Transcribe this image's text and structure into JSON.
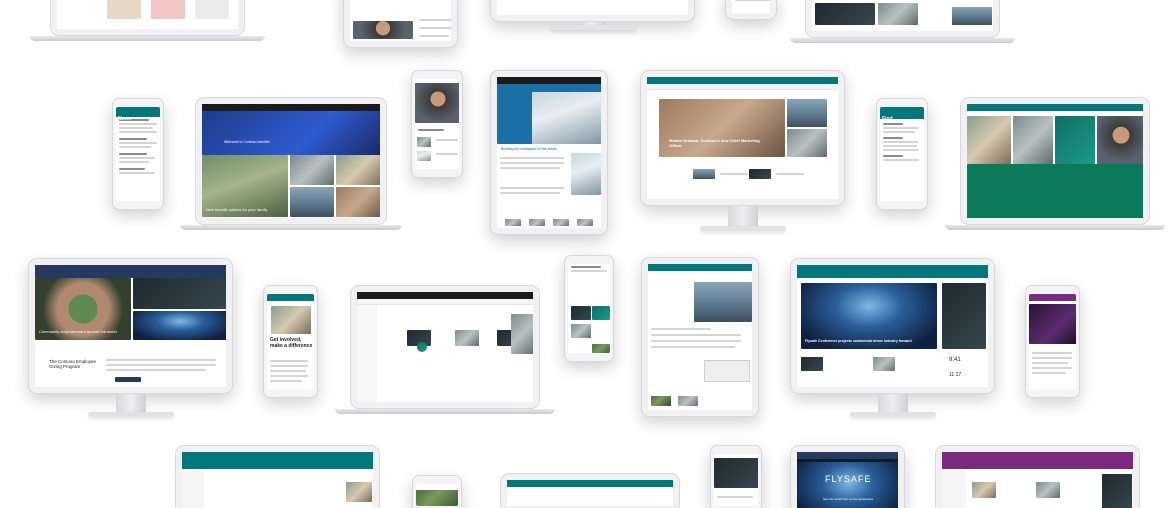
{
  "colors": {
    "suite_bar_dark": "#1b1b1b",
    "teal": "#03787c",
    "purple": "#7b2a7e",
    "navy": "#243a5e",
    "green_footer": "#0b7a5a"
  },
  "tiles": {
    "benefits": {
      "caption": "New benefit options for your family",
      "banner": "Welcome to Contoso benefits"
    },
    "phone_news": {
      "app_title": "News"
    },
    "phone_find": {
      "app_title": "Find"
    },
    "architecture": {
      "heading": "Building the workspace of the future"
    },
    "leaders": {
      "caption": "Miriam Graham, Contoso's new Chief Marketing Officer"
    },
    "giving": {
      "hero": "Community empowerment around the world",
      "title": "The Contoso Employee Giving Program"
    },
    "get_involved": {
      "title": "Get involved, make a difference"
    },
    "drone": {
      "caption": "Flysafe Conference projects commercial drone industry forward"
    },
    "weather": {
      "temp_high": "9:41",
      "temp_low": "11:17"
    },
    "flysafe": {
      "logo": "FLYSAFE",
      "tagline": "See the world from a new perspective"
    }
  }
}
